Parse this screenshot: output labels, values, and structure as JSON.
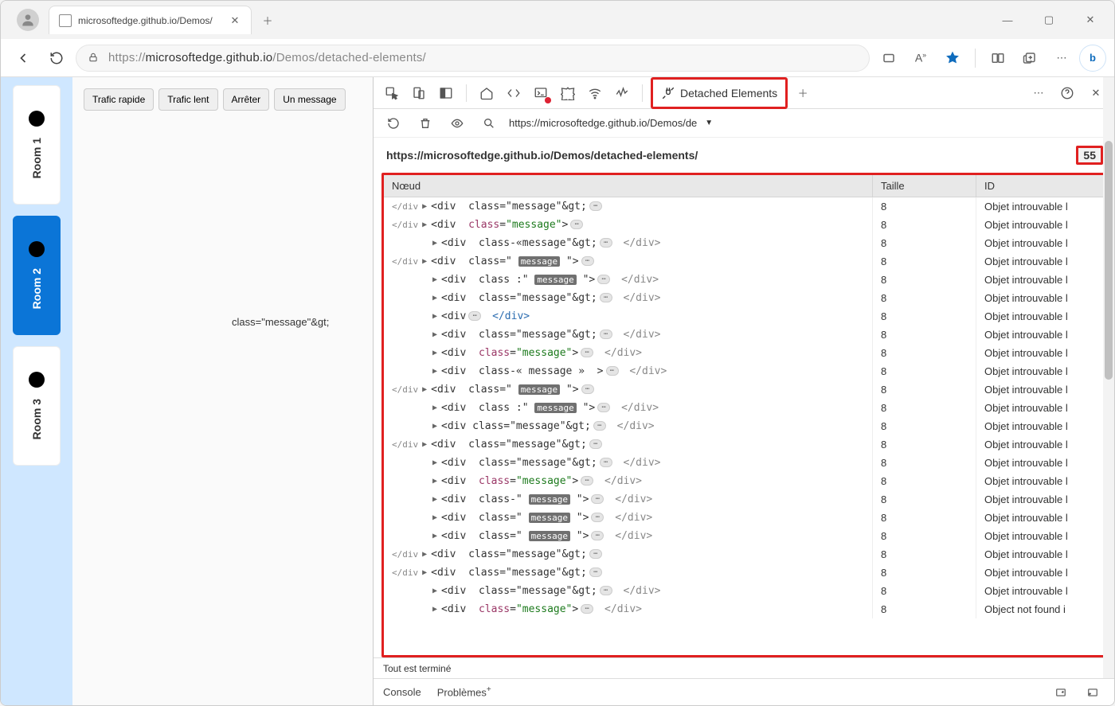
{
  "browser": {
    "tab_title": "microsoftedge.github.io/Demos/",
    "url_display_prefix": "https://",
    "url_display_domain": "microsoftedge.github.io",
    "url_display_path": "/Demos/detached-elements/"
  },
  "page": {
    "rooms": [
      {
        "label": "Room 1",
        "active": false
      },
      {
        "label": "Room 2",
        "active": true
      },
      {
        "label": "Room 3",
        "active": false
      }
    ],
    "buttons": {
      "fast": "Trafic rapide",
      "slow": "Trafic lent",
      "stop": "Arrêter",
      "one": "Un message"
    },
    "stray_text": "class=\"message\"&gt;"
  },
  "devtools": {
    "tabs": {
      "detached_elements": "Detached Elements"
    },
    "sub_url": "https://microsoftedge.github.io/Demos/de",
    "panel": {
      "title_url": "https://microsoftedge.github.io/Demos/detached-elements/",
      "count": "55",
      "columns": {
        "node": "Nœud",
        "size": "Taille",
        "id": "ID"
      },
      "rows": [
        {
          "indent": 0,
          "prefix": "</div",
          "arrow": "▶",
          "node_html": "<span class='tag'>&lt;div</span>&nbsp;&nbsp;<span class='attrplain'>class=\"message\"&amp;gt;</span>",
          "badge": true,
          "closing": "",
          "size": "8",
          "id": "Objet introuvable l"
        },
        {
          "indent": 0,
          "prefix": "</div",
          "arrow": "▶",
          "node_html": "<span class='tag'>&lt;div</span>&nbsp;&nbsp;<span class='attrname'>class</span>=<span class='attrval'>\"message\"</span>&gt;",
          "badge": true,
          "closing": "",
          "size": "8",
          "id": "Objet introuvable l"
        },
        {
          "indent": 1,
          "prefix": "",
          "arrow": "▶",
          "node_html": "<span class='tag'>&lt;div</span>&nbsp;&nbsp;<span class='attrplain'>class-«message\"&amp;gt;</span>",
          "badge": true,
          "closing": "</div>",
          "closing_style": "plain",
          "size": "8",
          "id": "Objet introuvable l"
        },
        {
          "indent": 0,
          "prefix": "</div",
          "arrow": "▶",
          "node_html": "<span class='tag'>&lt;div</span>&nbsp;&nbsp;<span class='attrplain'>class=\"</span>&nbsp;<span class='hl'>message</span>&nbsp;\"&gt;",
          "badge": true,
          "closing": "",
          "size": "8",
          "id": "Objet introuvable l"
        },
        {
          "indent": 1,
          "prefix": "",
          "arrow": "▶",
          "node_html": "<span class='tag'>&lt;div</span>&nbsp;&nbsp;<span class='attrplain'>class :\"</span>&nbsp;<span class='hl'>message</span>&nbsp;\"&gt;",
          "badge": true,
          "closing": "</div>",
          "closing_style": "plain",
          "size": "8",
          "id": "Objet introuvable l"
        },
        {
          "indent": 1,
          "prefix": "",
          "arrow": "▶",
          "node_html": "<span class='tag'>&lt;div</span>&nbsp;&nbsp;<span class='attrplain'>class=\"message\"&amp;gt;</span>",
          "badge": true,
          "closing": "</div>",
          "closing_style": "plain",
          "size": "8",
          "id": "Objet introuvable l"
        },
        {
          "indent": 1,
          "prefix": "",
          "arrow": "▶",
          "node_html": "<span class='tag'>&lt;div</span>",
          "badge": true,
          "closing": "</div>",
          "closing_style": "colored",
          "size": "8",
          "id": "Objet introuvable l"
        },
        {
          "indent": 1,
          "prefix": "",
          "arrow": "▶",
          "node_html": "<span class='tag'>&lt;div</span>&nbsp;&nbsp;<span class='attrplain'>class=\"message\"&amp;gt;</span>",
          "badge": true,
          "closing": "</div>",
          "closing_style": "plain",
          "size": "8",
          "id": "Objet introuvable l"
        },
        {
          "indent": 1,
          "prefix": "",
          "arrow": "▶",
          "node_html": "<span class='tag'>&lt;div</span>&nbsp;&nbsp;<span class='attrname'>class</span>=<span class='attrval'>\"message\"</span>&gt;",
          "badge": true,
          "closing": "</div>",
          "closing_style": "plain",
          "size": "8",
          "id": "Objet introuvable l"
        },
        {
          "indent": 1,
          "prefix": "",
          "arrow": "▶",
          "node_html": "<span class='tag'>&lt;div</span>&nbsp;&nbsp;<span class='attrplain'>class-« message »&nbsp; &gt;</span>",
          "badge": true,
          "closing": "</div>",
          "closing_style": "plain",
          "size": "8",
          "id": "Objet introuvable l"
        },
        {
          "indent": 0,
          "prefix": "</div",
          "arrow": "▶",
          "node_html": "<span class='tag'>&lt;div</span>&nbsp;&nbsp;<span class='attrplain'>class=\"</span>&nbsp;<span class='hl'>message</span>&nbsp;\"&gt;",
          "badge": true,
          "closing": "",
          "size": "8",
          "id": "Objet introuvable l"
        },
        {
          "indent": 1,
          "prefix": "",
          "arrow": "▶",
          "node_html": "<span class='tag'>&lt;div</span>&nbsp;&nbsp;<span class='attrplain'>class :\"</span>&nbsp;<span class='hl'>message</span>&nbsp;\"&gt;",
          "badge": true,
          "closing": "</div>",
          "closing_style": "plain",
          "size": "8",
          "id": "Objet introuvable l"
        },
        {
          "indent": 1,
          "prefix": "",
          "arrow": "▶",
          "node_html": "<span class='tag'>&lt;div class=\"message\"&amp;gt;</span>",
          "badge": true,
          "closing": "</div>",
          "closing_style": "plain",
          "size": "8",
          "id": "Objet introuvable l"
        },
        {
          "indent": 0,
          "prefix": "</div",
          "arrow": "▶",
          "node_html": "<span class='tag'>&lt;div</span>&nbsp;&nbsp;<span class='attrplain'>class=\"message\"&amp;gt;</span>",
          "badge": true,
          "closing": "",
          "size": "8",
          "id": "Objet introuvable l"
        },
        {
          "indent": 1,
          "prefix": "",
          "arrow": "▶",
          "node_html": "<span class='tag'>&lt;div</span>&nbsp;&nbsp;<span class='attrplain'>class=\"message\"&amp;gt;</span>",
          "badge": true,
          "closing": "</div>",
          "closing_style": "plain",
          "size": "8",
          "id": "Objet introuvable l"
        },
        {
          "indent": 1,
          "prefix": "",
          "arrow": "▶",
          "node_html": "<span class='tag'>&lt;div</span>&nbsp;&nbsp;<span class='attrname'>class</span>=<span class='attrval'>\"message\"</span>&gt;",
          "badge": true,
          "closing": "</div>",
          "closing_style": "plain",
          "size": "8",
          "id": "Objet introuvable l"
        },
        {
          "indent": 1,
          "prefix": "",
          "arrow": "▶",
          "node_html": "<span class='tag'>&lt;div</span>&nbsp;&nbsp;<span class='attrplain'>class-\"</span>&nbsp;<span class='hl'>message</span>&nbsp;\"&gt;",
          "badge": true,
          "closing": "</div>",
          "closing_style": "plain",
          "size": "8",
          "id": "Objet introuvable l"
        },
        {
          "indent": 1,
          "prefix": "",
          "arrow": "▶",
          "node_html": "<span class='tag'>&lt;div</span>&nbsp;&nbsp;<span class='attrplain'>class=\"</span>&nbsp;<span class='hl'>message</span>&nbsp;\"&gt;",
          "badge": true,
          "closing": "</div>",
          "closing_style": "plain",
          "size": "8",
          "id": "Objet introuvable l"
        },
        {
          "indent": 1,
          "prefix": "",
          "arrow": "▶",
          "node_html": "<span class='tag'>&lt;div</span>&nbsp;&nbsp;<span class='attrplain'>class=\"</span>&nbsp;<span class='hl'>message</span>&nbsp;\"&gt;",
          "badge": true,
          "closing": "</div>",
          "closing_style": "plain",
          "size": "8",
          "id": "Objet introuvable l"
        },
        {
          "indent": 0,
          "prefix": "</div",
          "arrow": "▶",
          "node_html": "<span class='tag'>&lt;div</span>&nbsp;&nbsp;<span class='attrplain'>class=\"message\"&amp;gt;</span>",
          "badge": true,
          "closing": "",
          "size": "8",
          "id": "Objet introuvable l"
        },
        {
          "indent": 0,
          "prefix": "</div",
          "arrow": "▶",
          "node_html": "<span class='tag'>&lt;div</span>&nbsp;&nbsp;<span class='attrplain'>class=\"message\"&amp;gt;</span>",
          "badge": true,
          "closing": "",
          "size": "8",
          "id": "Objet introuvable l"
        },
        {
          "indent": 1,
          "prefix": "",
          "arrow": "▶",
          "node_html": "<span class='tag'>&lt;div</span>&nbsp;&nbsp;<span class='attrplain'>class=\"message\"&amp;gt;</span>",
          "badge": true,
          "closing": "</div>",
          "closing_style": "plain",
          "size": "8",
          "id": "Objet introuvable l"
        },
        {
          "indent": 1,
          "prefix": "",
          "arrow": "▶",
          "node_html": "<span class='tag'>&lt;div</span>&nbsp;&nbsp;<span class='attrname'>class</span>=<span class='attrval'>\"message\"</span>&gt;",
          "badge": true,
          "closing": "</div>",
          "closing_style": "plain",
          "size": "8",
          "id": "Object not found i"
        }
      ]
    },
    "status_text": "Tout est terminé",
    "drawer": {
      "console": "Console",
      "problems": "Problèmes"
    }
  }
}
